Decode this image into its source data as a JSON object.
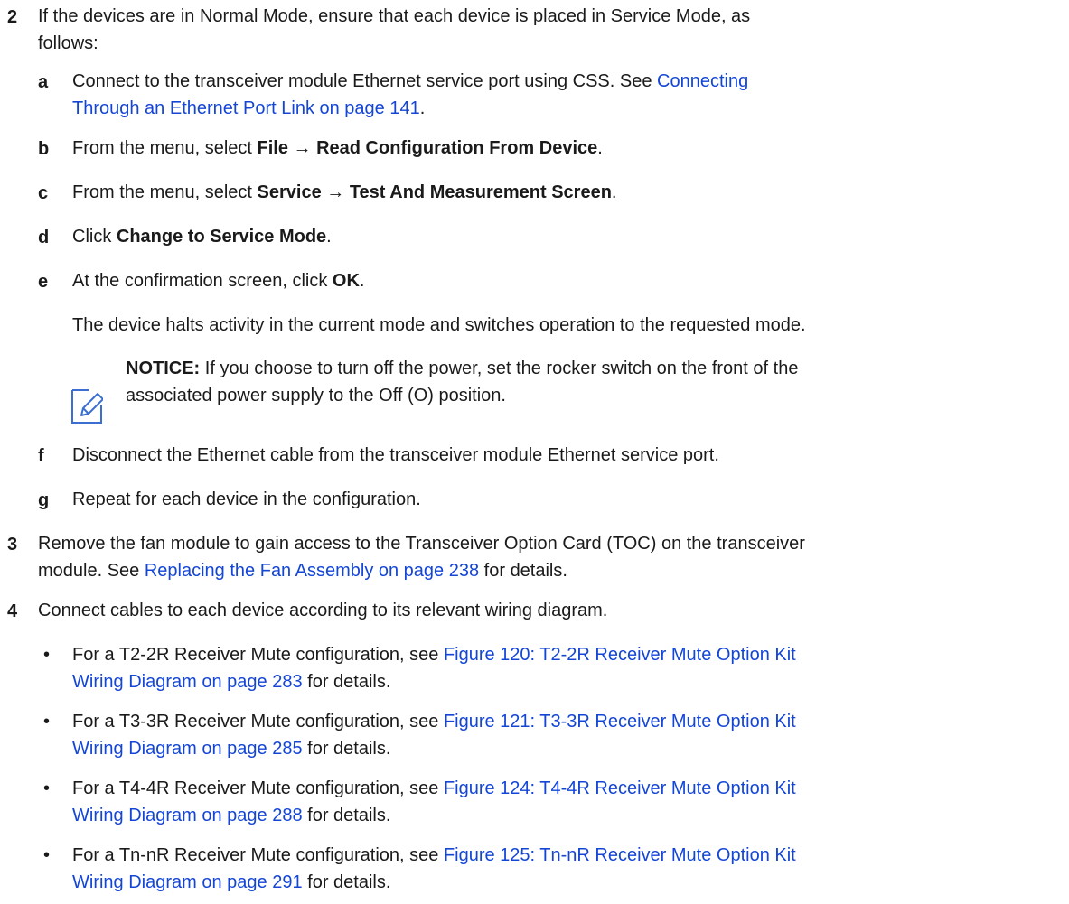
{
  "step2": {
    "num": "2",
    "text": "If the devices are in Normal Mode, ensure that each device is placed in Service Mode, as follows:",
    "line1": "If the devices are in Normal Mode, ensure that each device is placed in Service Mode, as",
    "line2": "follows:",
    "substeps": {
      "a": {
        "letter": "a",
        "pre": "Connect to the transceiver module Ethernet service port using CSS. See ",
        "link_l1": "Connecting",
        "link_l2": "Through an Ethernet Port Link on page 141",
        "post": "."
      },
      "b": {
        "letter": "b",
        "pre": "From the menu, select ",
        "bold": "File → Read Configuration From Device",
        "post": "."
      },
      "c": {
        "letter": "c",
        "pre": "From the menu, select ",
        "bold": "Service → Test And Measurement Screen",
        "post": "."
      },
      "d": {
        "letter": "d",
        "pre": "Click ",
        "bold": "Change to Service Mode",
        "post": "."
      },
      "e": {
        "letter": "e",
        "pre": "At the confirmation screen, click ",
        "bold": "OK",
        "post": "."
      },
      "e_result": "The device halts activity in the current mode and switches operation to the requested mode.",
      "notice": {
        "label": "NOTICE:",
        "l1": " If you choose to turn off the power, set the rocker switch on the front of the",
        "l2": "associated power supply to the Off (O) position."
      },
      "f": {
        "letter": "f",
        "text": "Disconnect the Ethernet cable from the transceiver module Ethernet service port."
      },
      "g": {
        "letter": "g",
        "text": "Repeat for each device in the configuration."
      }
    }
  },
  "step3": {
    "num": "3",
    "l1": "Remove the fan module to gain access to the Transceiver Option Card (TOC) on the transceiver",
    "l2_pre": "module. See ",
    "l2_link": "Replacing the Fan Assembly on page 238",
    "l2_post": " for details."
  },
  "step4": {
    "num": "4",
    "text": "Connect cables to each device according to its relevant wiring diagram.",
    "bullets": [
      {
        "pre": "For a T2-2R Receiver Mute configuration, see ",
        "link_l1": "Figure 120: T2-2R Receiver Mute Option Kit",
        "link_l2": "Wiring Diagram on page 283",
        "post": " for details."
      },
      {
        "pre": "For a T3-3R Receiver Mute configuration, see ",
        "link_l1": "Figure 121: T3-3R Receiver Mute Option Kit",
        "link_l2": "Wiring Diagram on page 285",
        "post": " for details."
      },
      {
        "pre": "For a T4-4R Receiver Mute configuration, see ",
        "link_l1": "Figure 124: T4-4R Receiver Mute Option Kit",
        "link_l2": "Wiring Diagram on page 288",
        "post": " for details."
      },
      {
        "pre": "For a Tn-nR Receiver Mute configuration, see ",
        "link_l1": "Figure 125: Tn-nR Receiver Mute Option Kit",
        "link_l2": "Wiring Diagram on page 291",
        "post": " for details."
      }
    ],
    "bullet_char": "•"
  },
  "colors": {
    "text": "#1a1a1a",
    "link": "#1446d6",
    "icon": "#3a6fd1"
  },
  "icons": {
    "notice": "pencil-note-icon"
  }
}
